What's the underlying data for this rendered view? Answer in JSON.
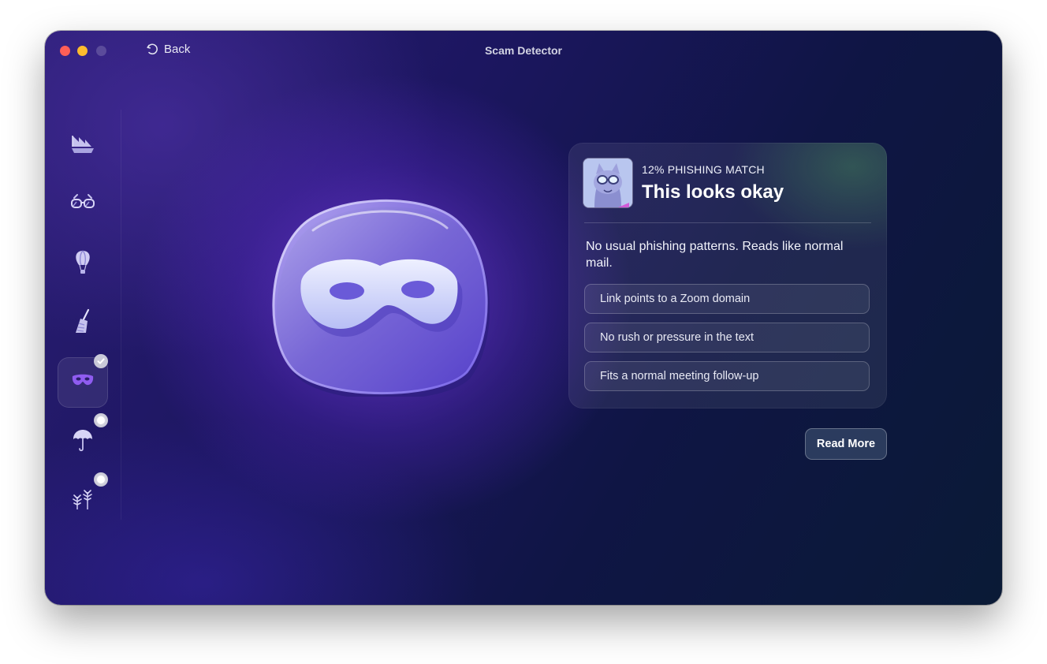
{
  "window": {
    "title": "Scam Detector",
    "back_label": "Back"
  },
  "sidebar": {
    "items": [
      {
        "icon": "ship-icon",
        "status": "none"
      },
      {
        "icon": "glasses-icon",
        "status": "none"
      },
      {
        "icon": "hot-air-balloon-icon",
        "status": "none"
      },
      {
        "icon": "broom-icon",
        "status": "none"
      },
      {
        "icon": "mask-icon",
        "status": "completed",
        "selected": true
      },
      {
        "icon": "umbrella-icon",
        "status": "pending"
      },
      {
        "icon": "plants-icon",
        "status": "pending"
      }
    ]
  },
  "hero": {
    "icon": "mask-icon"
  },
  "result": {
    "match_label": "12% PHISHING MATCH",
    "headline": "This looks okay",
    "summary": "No usual phishing patterns. Reads like normal mail.",
    "reasons": [
      "Link points to a Zoom domain",
      "No rush or pressure in the text",
      "Fits a normal meeting follow-up"
    ]
  },
  "actions": {
    "read_more_label": "Read More"
  },
  "colors": {
    "close": "#fe5f57",
    "minimize": "#febc2e",
    "accent_purple": "#7b5cf0"
  }
}
